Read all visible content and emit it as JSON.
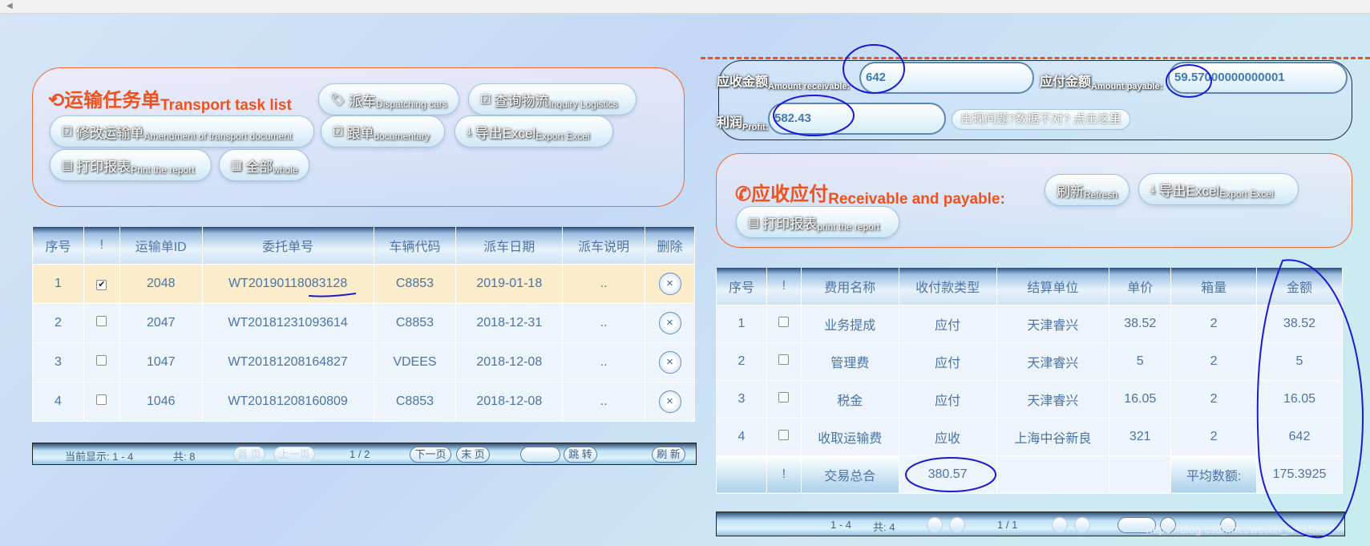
{
  "left_panel": {
    "title": "运输任务单",
    "title_en": "Transport task list",
    "buttons": [
      {
        "label": "派车",
        "en": "Dispatching cars"
      },
      {
        "label": "查询物流",
        "en": "Inquiry Logistics"
      },
      {
        "label": "修改运输单",
        "en": "Amendment of transport document"
      },
      {
        "label": "跟单",
        "en": "documentary"
      },
      {
        "label": "导出Excel",
        "en": "Export Excel"
      },
      {
        "label": "打印报表",
        "en": "Print the report"
      },
      {
        "label": "全部",
        "en": "whole"
      }
    ]
  },
  "transport_table": {
    "headers": [
      "序号",
      "!",
      "运输单ID",
      "委托单号",
      "车辆代码",
      "派车日期",
      "派车说明",
      "删除"
    ],
    "rows": [
      {
        "idx": "1",
        "checked": true,
        "id": "2048",
        "order": "WT20190118083128",
        "vehicle": "C8853",
        "date": "2019-01-18",
        "note": ".."
      },
      {
        "idx": "2",
        "checked": false,
        "id": "2047",
        "order": "WT20181231093614",
        "vehicle": "C8853",
        "date": "2018-12-31",
        "note": ".."
      },
      {
        "idx": "3",
        "checked": false,
        "id": "1047",
        "order": "WT20181208164827",
        "vehicle": "VDEES",
        "date": "2018-12-08",
        "note": ".."
      },
      {
        "idx": "4",
        "checked": false,
        "id": "1046",
        "order": "WT20181208160809",
        "vehicle": "C8853",
        "date": "2018-12-08",
        "note": ".."
      }
    ],
    "delete_symbol": "×"
  },
  "left_pager": {
    "current": "当前显示: 1 - 4",
    "total": "共: 8",
    "first": "首 页",
    "prev": "上一页",
    "page": "1 / 2",
    "next": "下一页",
    "last": "末 页",
    "jump": "跳 转",
    "refresh": "刷 新"
  },
  "info": {
    "receivable_label": "应收金额",
    "receivable_en": "Amount receivable:",
    "receivable_value": "642",
    "payable_label": "应付金额",
    "payable_en": "Amount payable:",
    "payable_value": "59.57000000000001",
    "profit_label": "利润",
    "profit_en": "Profit:",
    "profit_value": "582.43",
    "problem_hint": "出现问题?数据不对? 点击这里"
  },
  "right_panel": {
    "title": "应收应付",
    "title_en": "Receivable and payable:",
    "buttons": [
      {
        "label": "刷新",
        "en": "Refresh"
      },
      {
        "label": "导出Excel",
        "en": "Export Excel"
      },
      {
        "label": "打印报表",
        "en": "print the report"
      }
    ]
  },
  "fee_table": {
    "headers": [
      "序号",
      "!",
      "费用名称",
      "收付款类型",
      "结算单位",
      "单价",
      "箱量",
      "金额"
    ],
    "rows": [
      {
        "idx": "1",
        "name": "业务提成",
        "type": "应付",
        "unit": "天津睿兴",
        "price": "38.52",
        "qty": "2",
        "amount": "38.52"
      },
      {
        "idx": "2",
        "name": "管理费",
        "type": "应付",
        "unit": "天津睿兴",
        "price": "5",
        "qty": "2",
        "amount": "5"
      },
      {
        "idx": "3",
        "name": "税金",
        "type": "应付",
        "unit": "天津睿兴",
        "price": "16.05",
        "qty": "2",
        "amount": "16.05"
      },
      {
        "idx": "4",
        "name": "收取运输费",
        "type": "应收",
        "unit": "上海中谷新良",
        "price": "321",
        "qty": "2",
        "amount": "642"
      }
    ],
    "summary": {
      "mark": "!",
      "total_label": "交易总合",
      "total_value": "380.57",
      "avg_label": "平均数额:",
      "avg_value": "175.3925"
    }
  },
  "right_pager": {
    "current": "1 - 4",
    "total": "共: 4",
    "page": "1 / 1"
  },
  "watermark": "https://blog.csdn.net/weixin_44548807",
  "colors": {
    "accent": "#f0521e",
    "header_text": "#4e74a6",
    "annotation": "#1a1ad6",
    "selected_row": "#fbeccb"
  }
}
